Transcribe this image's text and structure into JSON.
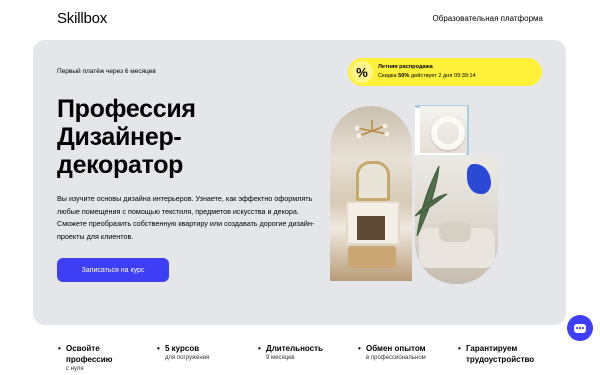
{
  "header": {
    "logo": "Skillbox",
    "platform_link": "Образовательная платформа"
  },
  "hero": {
    "installment": "Первый платёж через 6 месяцев",
    "title_lines": [
      "Профессия",
      "Дизайнер-",
      "декоратор"
    ],
    "description": "Вы изучите основы дизайна интерьеров. Узнаете, как эффектно оформлять любые помещения с помощью текстиля, предметов искусства и декора. Сможете преобразить собственную квартиру или создавать дорогие дизайн-проекты для клиентов.",
    "cta_label": "Записаться на курс"
  },
  "promo": {
    "icon": "%",
    "icon_name": "percent-icon",
    "title": "Летняя распродажа",
    "text_prefix": "Скидка ",
    "discount": "50%",
    "text_suffix": " действует 2 дня 09:39:14",
    "color": "#fff13a"
  },
  "colors": {
    "accent": "#3e3ef4",
    "hero_bg": "#e5e6ea"
  },
  "features": [
    {
      "title_lines": [
        "Освойте",
        "профессию"
      ],
      "sub": "с нуля"
    },
    {
      "title_lines": [
        "5 курсов"
      ],
      "sub": "для погружения"
    },
    {
      "title_lines": [
        "Длительность"
      ],
      "sub": "9 месяцев"
    },
    {
      "title_lines": [
        "Обмен опытом"
      ],
      "sub": "в профессиональном"
    },
    {
      "title_lines": [
        "Гарантируем",
        "трудоустройство"
      ],
      "sub": ""
    }
  ],
  "chat": {
    "icon": "chat-bubble-icon"
  }
}
